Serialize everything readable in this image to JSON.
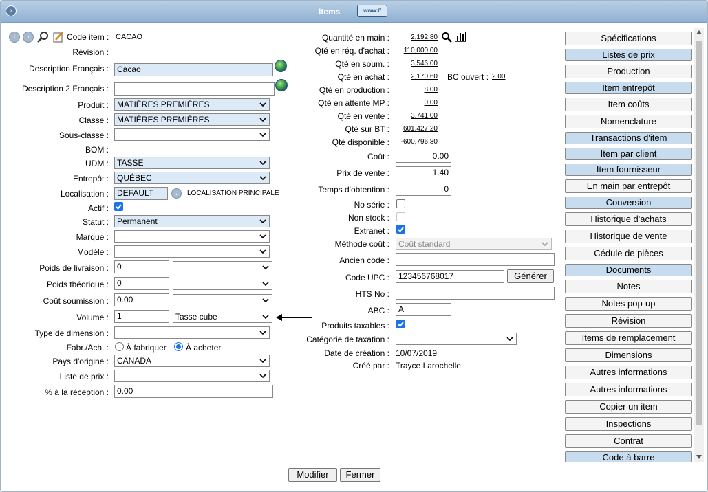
{
  "window": {
    "title": "Items",
    "www_label": "www://"
  },
  "left": {
    "code_item_label": "Code item :",
    "code_item_value": "CACAO",
    "revision_label": "Révision :",
    "desc_fr_label": "Description Français :",
    "desc_fr_value": "Cacao",
    "desc2_fr_label": "Description 2 Français :",
    "desc2_fr_value": "",
    "produit_label": "Produit :",
    "produit_value": "MATIÈRES PREMIÈRES",
    "classe_label": "Classe :",
    "classe_value": "MATIÈRES PREMIÈRES",
    "sous_classe_label": "Sous-classe :",
    "sous_classe_value": "",
    "bom_label": "BOM :",
    "udm_label": "UDM :",
    "udm_value": "TASSE",
    "entrepot_label": "Entrepôt :",
    "entrepot_value": "QUÉBEC",
    "localisation_label": "Localisation :",
    "localisation_value": "DEFAULT",
    "localisation_principale": "LOCALISATION PRINCIPALE",
    "actif_label": "Actif :",
    "statut_label": "Statut :",
    "statut_value": "Permanent",
    "marque_label": "Marque :",
    "modele_label": "Modèle :",
    "poids_livraison_label": "Poids de livraison :",
    "poids_livraison_value": "0",
    "poids_theorique_label": "Poids théorique :",
    "poids_theorique_value": "0",
    "cout_soumission_label": "Coût soumission :",
    "cout_soumission_value": "0.00",
    "volume_label": "Volume :",
    "volume_value": "1",
    "volume_unit": "Tasse cube",
    "type_dimension_label": "Type de dimension :",
    "fabr_ach_label": "Fabr./Ach. :",
    "a_fabriquer": "À fabriquer",
    "a_acheter": "À acheter",
    "pays_origine_label": "Pays d'origine :",
    "pays_origine_value": "CANADA",
    "liste_prix_label": "Liste de prix :",
    "pct_reception_label": "% à la réception :",
    "pct_reception_value": "0.00"
  },
  "middle": {
    "qte_main_label": "Quantité en main :",
    "qte_main_value": "2,192.80",
    "qte_req_achat_label": "Qté en réq. d'achat :",
    "qte_req_achat_value": "110,000.00",
    "qte_soum_label": "Qté en soum. :",
    "qte_soum_value": "3,546.00",
    "qte_achat_label": "Qté en achat :",
    "qte_achat_value": "2,170.60",
    "bc_ouvert_label": "BC ouvert :",
    "bc_ouvert_value": "2.00",
    "qte_production_label": "Qté en production :",
    "qte_production_value": "8.00",
    "qte_attente_label": "Qté en attente MP :",
    "qte_attente_value": "0.00",
    "qte_vente_label": "Qté en vente :",
    "qte_vente_value": "3,741.00",
    "qte_bt_label": "Qté sur BT :",
    "qte_bt_value": "601,427.20",
    "qte_dispo_label": "Qté disponible :",
    "qte_dispo_value": "-600,796.80",
    "cout_label": "Coût :",
    "cout_value": "0.00",
    "prix_vente_label": "Prix de vente :",
    "prix_vente_value": "1.40",
    "temps_obtention_label": "Temps d'obtention :",
    "temps_obtention_value": "0",
    "no_serie_label": "No série :",
    "non_stock_label": "Non stock :",
    "extranet_label": "Extranet :",
    "methode_cout_label": "Méthode coût :",
    "methode_cout_value": "Coût standard",
    "ancien_code_label": "Ancien code :",
    "code_upc_label": "Code UPC :",
    "code_upc_value": "123456768017",
    "generer_label": "Générer",
    "hts_label": "HTS No :",
    "abc_label": "ABC :",
    "abc_value": "A",
    "produits_taxables_label": "Produits taxables :",
    "categorie_taxation_label": "Catégorie de taxation :",
    "date_creation_label": "Date de création :",
    "date_creation_value": "10/07/2019",
    "cree_par_label": "Créé par :",
    "cree_par_value": "Trayce Larochelle"
  },
  "sidebar": [
    "Spécifications",
    "Listes de prix",
    "Production",
    "Item entrepôt",
    "Item coûts",
    "Nomenclature",
    "Transactions d'item",
    "Item par client",
    "Item fournisseur",
    "En main par entrepôt",
    "Conversion",
    "Historique d'achats",
    "Historique de vente",
    "Cédule de pièces",
    "Documents",
    "Notes",
    "Notes pop-up",
    "Révision",
    "Items de remplacement",
    "Dimensions",
    "Autres informations",
    "Autres informations",
    "Copier un item",
    "Inspections",
    "Contrat",
    "Code à barre"
  ],
  "footer": {
    "modifier": "Modifier",
    "fermer": "Fermer"
  }
}
